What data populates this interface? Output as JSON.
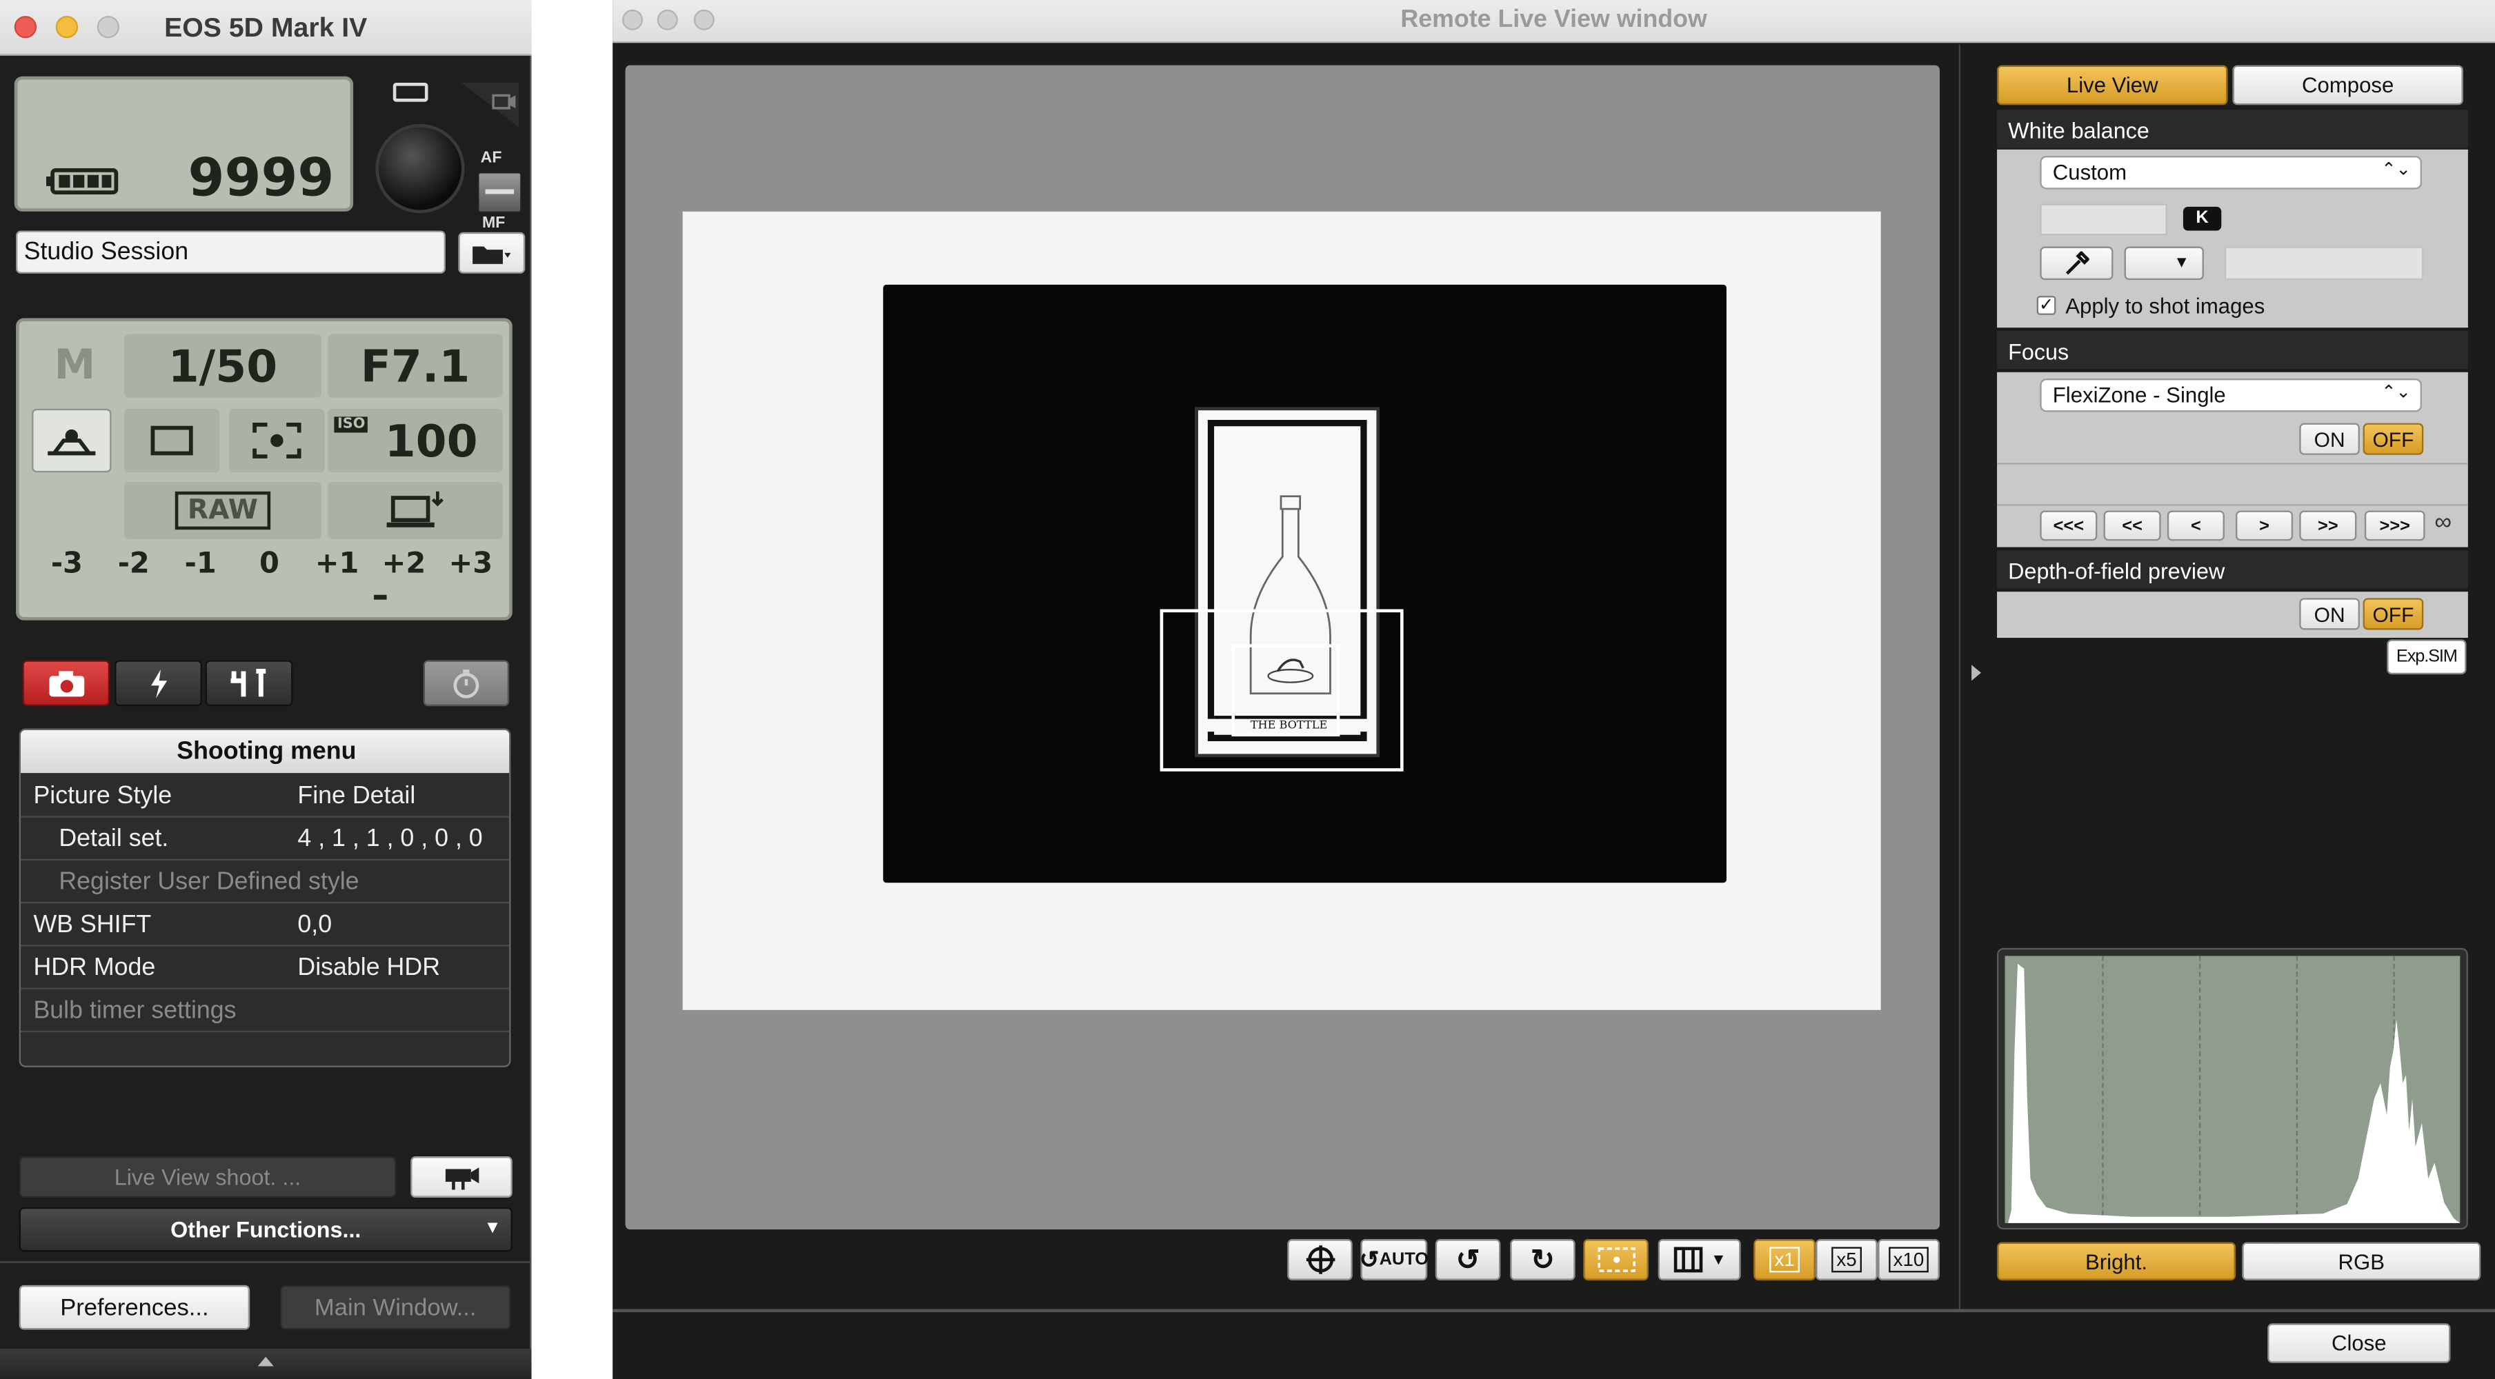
{
  "left_window": {
    "title": "EOS 5D Mark IV",
    "shots_remaining": "9999",
    "af_label": "AF",
    "mf_label": "MF",
    "session_name": "Studio Session",
    "mode": "M",
    "shutter": "1/50",
    "aperture": "F7.1",
    "iso_label": "ISO",
    "iso": "100",
    "quality": "RAW",
    "exposure_scale": [
      "-3",
      "-2",
      "-1",
      "0",
      "+1",
      "+2",
      "+3"
    ],
    "tabs": [
      "shooting",
      "flash",
      "tools"
    ],
    "shooting_menu": {
      "title": "Shooting menu",
      "rows": [
        {
          "key": "Picture Style",
          "value": "Fine Detail",
          "dim": false,
          "indent": false
        },
        {
          "key": "Detail set.",
          "value": "4 , 1 , 1 , 0 , 0 , 0",
          "dim": false,
          "indent": true
        },
        {
          "key": "Register User Defined style",
          "value": "",
          "dim": true,
          "indent": true
        },
        {
          "key": "WB SHIFT",
          "value": "0,0",
          "dim": false,
          "indent": false
        },
        {
          "key": "HDR Mode",
          "value": "Disable HDR",
          "dim": false,
          "indent": false
        },
        {
          "key": "Bulb timer settings",
          "value": "",
          "dim": true,
          "indent": false
        }
      ]
    },
    "live_view_shoot": "Live View shoot. ...",
    "other_functions": "Other Functions...",
    "preferences": "Preferences...",
    "main_window": "Main Window..."
  },
  "right_window": {
    "title": "Remote Live View window",
    "tabs": {
      "live_view": "Live View",
      "compose": "Compose"
    },
    "white_balance": {
      "heading": "White balance",
      "mode": "Custom",
      "kelvin_unit": "K",
      "apply_label": "Apply to shot images",
      "apply_checked": true
    },
    "focus": {
      "heading": "Focus",
      "mode": "FlexiZone - Single",
      "on": "ON",
      "off": "OFF",
      "nav": [
        "<<<",
        "<<",
        "<",
        ">",
        ">>",
        ">>>"
      ],
      "infinity": "∞"
    },
    "dof": {
      "heading": "Depth-of-field preview",
      "on": "ON",
      "off": "OFF",
      "exp_sim": "Exp.SIM"
    },
    "histogram": {
      "bright": "Bright.",
      "rgb": "RGB",
      "selected": "Bright."
    },
    "toolbar": {
      "auto": "AUTO",
      "zoom": [
        "x1",
        "x5",
        "x10"
      ],
      "zoom_selected": "x1"
    },
    "preview_caption": "THE BOTTLE",
    "close": "Close"
  }
}
